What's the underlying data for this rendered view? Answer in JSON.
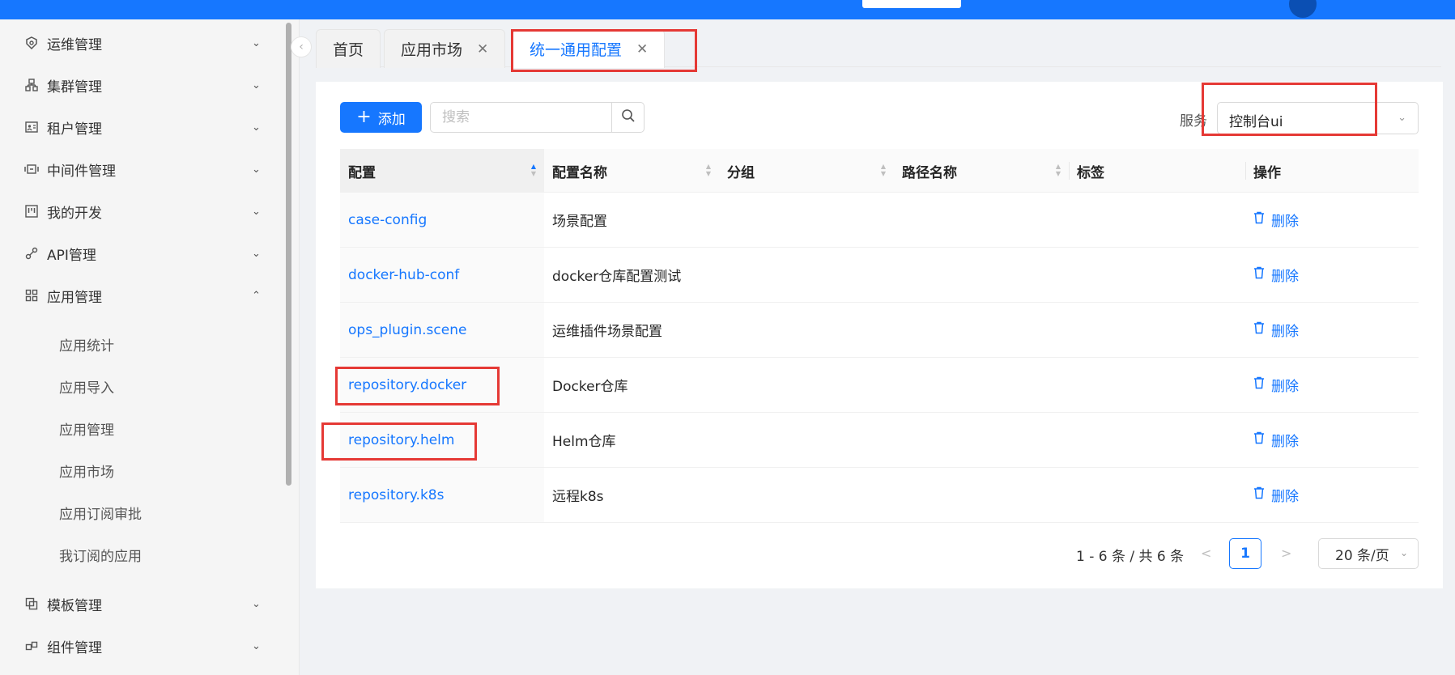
{
  "sidebar": {
    "items": [
      {
        "label": "运维管理",
        "icon": "ops-icon",
        "expanded": false
      },
      {
        "label": "集群管理",
        "icon": "cluster-icon",
        "expanded": false
      },
      {
        "label": "租户管理",
        "icon": "tenant-icon",
        "expanded": false
      },
      {
        "label": "中间件管理",
        "icon": "middleware-icon",
        "expanded": false
      },
      {
        "label": "我的开发",
        "icon": "dev-icon",
        "expanded": false
      },
      {
        "label": "API管理",
        "icon": "api-icon",
        "expanded": false
      },
      {
        "label": "应用管理",
        "icon": "app-grid-icon",
        "expanded": true
      },
      {
        "label": "模板管理",
        "icon": "template-icon",
        "expanded": false
      },
      {
        "label": "组件管理",
        "icon": "component-icon",
        "expanded": false
      }
    ],
    "subitems": [
      "应用统计",
      "应用导入",
      "应用管理",
      "应用市场",
      "应用订阅审批",
      "我订阅的应用"
    ]
  },
  "tabs": [
    {
      "label": "首页",
      "closable": false,
      "active": false
    },
    {
      "label": "应用市场",
      "closable": true,
      "active": false
    },
    {
      "label": "统一通用配置",
      "closable": true,
      "active": true
    }
  ],
  "toolbar": {
    "add_label": "添加",
    "search_placeholder": "搜索",
    "service_label": "服务",
    "service_value": "控制台ui"
  },
  "table": {
    "columns": [
      "配置",
      "配置名称",
      "分组",
      "路径名称",
      "标签",
      "操作"
    ],
    "rows": [
      {
        "config": "case-config",
        "name": "场景配置",
        "group": "",
        "path": "",
        "tag": "",
        "action": "删除"
      },
      {
        "config": "docker-hub-conf",
        "name": "docker仓库配置测试",
        "group": "",
        "path": "",
        "tag": "",
        "action": "删除"
      },
      {
        "config": "ops_plugin.scene",
        "name": "运维插件场景配置",
        "group": "",
        "path": "",
        "tag": "",
        "action": "删除"
      },
      {
        "config": "repository.docker",
        "name": "Docker仓库",
        "group": "",
        "path": "",
        "tag": "",
        "action": "删除"
      },
      {
        "config": "repository.helm",
        "name": "Helm仓库",
        "group": "",
        "path": "",
        "tag": "",
        "action": "删除"
      },
      {
        "config": "repository.k8s",
        "name": "远程k8s",
        "group": "",
        "path": "",
        "tag": "",
        "action": "删除"
      }
    ]
  },
  "pagination": {
    "total_text": "1 - 6 条 / 共 6 条",
    "current_page": "1",
    "page_size": "20 条/页"
  },
  "colors": {
    "primary": "#1677ff",
    "highlight_box": "#e53935"
  }
}
